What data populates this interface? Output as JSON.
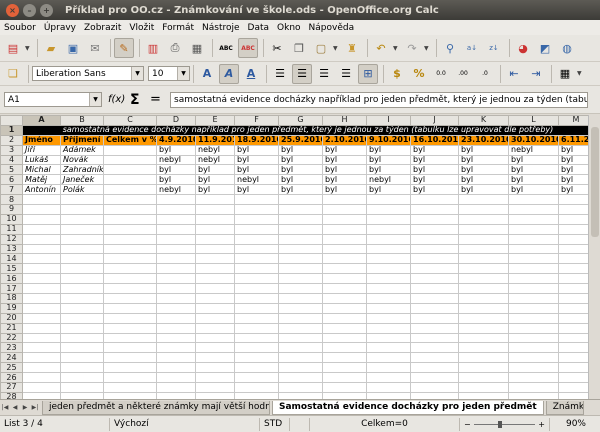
{
  "window": {
    "title": "Příklad pro OO.cz - Známkování ve škole.ods - OpenOffice.org Calc"
  },
  "menu": [
    "Soubor",
    "Úpravy",
    "Zobrazit",
    "Vložit",
    "Formát",
    "Nástroje",
    "Data",
    "Okno",
    "Nápověda"
  ],
  "toolbar2": {
    "font_name": "Liberation Sans",
    "font_size": "10"
  },
  "formula_bar": {
    "cell_ref": "A1",
    "fx": "f(x)",
    "sum": "Σ",
    "equals": "=",
    "content": "samostatná evidence docházky například pro jeden předmět, který je jednou za týden (tabulku lze upravo"
  },
  "grid": {
    "corner": "",
    "columns": [
      "A",
      "B",
      "C",
      "D",
      "E",
      "F",
      "G",
      "H",
      "I",
      "J",
      "K",
      "L",
      "M"
    ],
    "row_numbers": [
      "1",
      "2",
      "3",
      "4",
      "5",
      "6",
      "7",
      "8",
      "9",
      "10",
      "11",
      "12",
      "13",
      "14",
      "15",
      "16",
      "17",
      "18",
      "19",
      "20",
      "21",
      "22",
      "23",
      "24",
      "25",
      "26",
      "27",
      "28"
    ],
    "row1_text": "samostatná evidence docházky například pro jeden předmět, který je jednou za týden (tabulku lze upravovat dle potřeby)",
    "header": [
      "Jméno",
      "Příjmení",
      "Celkem v %",
      "4.9.2010",
      "11.9.2010",
      "18.9.2010",
      "25.9.2010",
      "2.10.2010",
      "9.10.2010",
      "16.10.2010",
      "23.10.2010",
      "30.10.2010",
      "6.11.20"
    ],
    "rows": [
      [
        "Jiří",
        "Adámek",
        "",
        "byl",
        "nebyl",
        "byl",
        "byl",
        "byl",
        "byl",
        "byl",
        "byl",
        "nebyl",
        "byl"
      ],
      [
        "Lukáš",
        "Novák",
        "",
        "nebyl",
        "nebyl",
        "byl",
        "byl",
        "byl",
        "byl",
        "byl",
        "byl",
        "byl",
        "byl"
      ],
      [
        "Michal",
        "Zahradník",
        "",
        "byl",
        "byl",
        "byl",
        "byl",
        "byl",
        "byl",
        "byl",
        "byl",
        "byl",
        "byl"
      ],
      [
        "Matěj",
        "Janeček",
        "",
        "byl",
        "byl",
        "nebyl",
        "byl",
        "byl",
        "nebyl",
        "byl",
        "byl",
        "byl",
        "byl"
      ],
      [
        "Antonín",
        "Polák",
        "",
        "nebyl",
        "byl",
        "byl",
        "byl",
        "byl",
        "byl",
        "byl",
        "byl",
        "byl",
        "byl"
      ]
    ]
  },
  "tabs": {
    "items": [
      "jeden předmět a některé známky mají větší hodnotu",
      "Samostatná evidence docházky pro jeden předmět",
      "Známk"
    ],
    "active_index": 1
  },
  "status": {
    "sheet": "List 3 / 4",
    "style": "Výchozí",
    "mode": "STD",
    "sum": "Celkem=0",
    "zoom": "90%"
  }
}
